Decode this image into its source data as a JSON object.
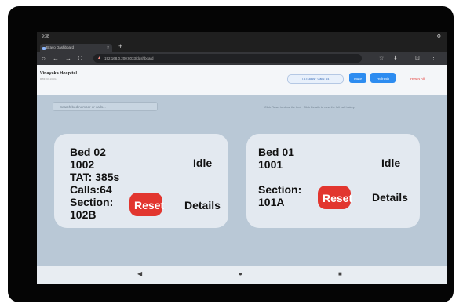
{
  "statusbar": {
    "time": "9:38",
    "signal": "⚙"
  },
  "browser": {
    "tab_title": "Bravo Dashboard",
    "new_tab": "+",
    "url": "192.168.0.200:8033/dashboard",
    "icons": {
      "back": "←",
      "forward": "→",
      "reload": "C",
      "star": "☆",
      "download": "⬇",
      "tabs": "⊡",
      "menu": "⋮",
      "lock": "▲"
    }
  },
  "app": {
    "hospital": "Vinayaka Hospital",
    "version": "Bed: 001/001",
    "status_pill": "TAT: 386s · Calls: 64",
    "mute_label": "Mute",
    "refresh_label": "Refresh",
    "reset_all_label": "Reset All",
    "search_placeholder": "Search bed number or calls...",
    "hint": "Click Reset to clear the bed · Click Details to view the full call history"
  },
  "beds": [
    {
      "info": "Bed 02\n1002\nTAT: 385s\nCalls:64\nSection:\n102B",
      "status": "Idle",
      "reset_label": "Reset",
      "details_label": "Details"
    },
    {
      "info": "Bed 01\n1001\n\nSection:\n101A",
      "status": "Idle",
      "reset_label": "Reset",
      "details_label": "Details"
    }
  ],
  "android_nav": {
    "back": "◀",
    "home": "●",
    "recents": "■"
  },
  "colors": {
    "accent": "#2d8cf0",
    "danger": "#e2362f",
    "background": "#b9c8d6",
    "card": "#e3e9f0"
  }
}
